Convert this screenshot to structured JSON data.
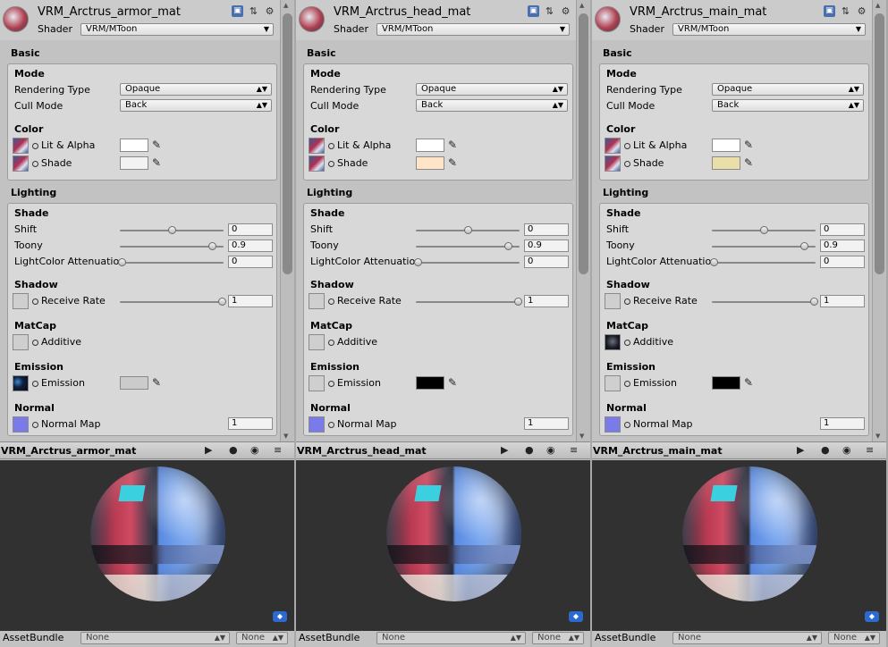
{
  "panels": [
    {
      "name": "VRM_Arctrus_armor_mat",
      "shader_label": "Shader",
      "shader_value": "VRM/MToon",
      "basic": "Basic",
      "mode": "Mode",
      "rendering_type_label": "Rendering Type",
      "rendering_type_value": "Opaque",
      "cull_mode_label": "Cull Mode",
      "cull_mode_value": "Back",
      "color": "Color",
      "lit_label": "Lit & Alpha",
      "lit_color": "#ffffff",
      "shade_label": "Shade",
      "shade_color": "#f2f2f2",
      "lighting": "Lighting",
      "shade_sub": "Shade",
      "shift_label": "Shift",
      "shift_value": "0",
      "shift_frac": 0.5,
      "toony_label": "Toony",
      "toony_value": "0.9",
      "toony_frac": 0.9,
      "lca_label": "LightColor Attenuation",
      "lca_value": "0",
      "lca_frac": 0.0,
      "shadow": "Shadow",
      "receive_label": "Receive Rate",
      "receive_value": "1",
      "receive_frac": 1.0,
      "matcap": "MatCap",
      "additive_label": "Additive",
      "matcap_tex": "none",
      "emission": "Emission",
      "emission_label": "Emission",
      "emission_color": "#cbcbcb",
      "emission_tex": "emis",
      "normal": "Normal",
      "normal_label": "Normal Map",
      "normal_value": "1",
      "preview_title": "VRM_Arctrus_armor_mat",
      "assetbundle_label": "AssetBundle",
      "ab_value1": "None",
      "ab_value2": "None"
    },
    {
      "name": "VRM_Arctrus_head_mat",
      "shader_label": "Shader",
      "shader_value": "VRM/MToon",
      "basic": "Basic",
      "mode": "Mode",
      "rendering_type_label": "Rendering Type",
      "rendering_type_value": "Opaque",
      "cull_mode_label": "Cull Mode",
      "cull_mode_value": "Back",
      "color": "Color",
      "lit_label": "Lit & Alpha",
      "lit_color": "#ffffff",
      "shade_label": "Shade",
      "shade_color": "#ffe4c8",
      "lighting": "Lighting",
      "shade_sub": "Shade",
      "shift_label": "Shift",
      "shift_value": "0",
      "shift_frac": 0.5,
      "toony_label": "Toony",
      "toony_value": "0.9",
      "toony_frac": 0.9,
      "lca_label": "LightColor Attenuation",
      "lca_value": "0",
      "lca_frac": 0.0,
      "shadow": "Shadow",
      "receive_label": "Receive Rate",
      "receive_value": "1",
      "receive_frac": 1.0,
      "matcap": "MatCap",
      "additive_label": "Additive",
      "matcap_tex": "none",
      "emission": "Emission",
      "emission_label": "Emission",
      "emission_color": "#000000",
      "emission_tex": "none",
      "normal": "Normal",
      "normal_label": "Normal Map",
      "normal_value": "1",
      "preview_title": "VRM_Arctrus_head_mat",
      "assetbundle_label": "AssetBundle",
      "ab_value1": "None",
      "ab_value2": "None"
    },
    {
      "name": "VRM_Arctrus_main_mat",
      "shader_label": "Shader",
      "shader_value": "VRM/MToon",
      "basic": "Basic",
      "mode": "Mode",
      "rendering_type_label": "Rendering Type",
      "rendering_type_value": "Opaque",
      "cull_mode_label": "Cull Mode",
      "cull_mode_value": "Back",
      "color": "Color",
      "lit_label": "Lit & Alpha",
      "lit_color": "#ffffff",
      "shade_label": "Shade",
      "shade_color": "#eadfa8",
      "lighting": "Lighting",
      "shade_sub": "Shade",
      "shift_label": "Shift",
      "shift_value": "0",
      "shift_frac": 0.5,
      "toony_label": "Toony",
      "toony_value": "0.9",
      "toony_frac": 0.9,
      "lca_label": "LightColor Attenuation",
      "lca_value": "0",
      "lca_frac": 0.0,
      "shadow": "Shadow",
      "receive_label": "Receive Rate",
      "receive_value": "1",
      "receive_frac": 1.0,
      "matcap": "MatCap",
      "additive_label": "Additive",
      "matcap_tex": "matcap",
      "emission": "Emission",
      "emission_label": "Emission",
      "emission_color": "#000000",
      "emission_tex": "none",
      "normal": "Normal",
      "normal_label": "Normal Map",
      "normal_value": "1",
      "preview_title": "VRM_Arctrus_main_mat",
      "assetbundle_label": "AssetBundle",
      "ab_value1": "None",
      "ab_value2": "None"
    }
  ],
  "icons": [
    "material-sphere-icon",
    "help-book-icon",
    "preset-sliders-icon",
    "gear-icon",
    "color-picker-icon",
    "play-icon",
    "sphere-toggle-icon",
    "light-toggle-icon",
    "menu-icon",
    "assetbundle-tag-icon"
  ]
}
